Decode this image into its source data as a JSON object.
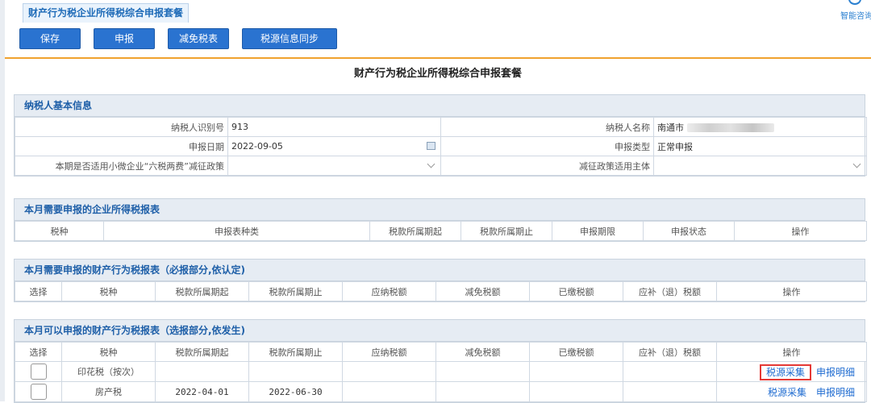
{
  "tab": {
    "title": "财产行为税企业所得税综合申报套餐"
  },
  "assistant": {
    "label": "智能咨询"
  },
  "toolbar": {
    "save": "保存",
    "submit": "申报",
    "reduction": "减免税表",
    "sync": "税源信息同步"
  },
  "page_title": "财产行为税企业所得税综合申报套餐",
  "basic": {
    "title": "纳税人基本信息",
    "tax_id_label": "纳税人识别号",
    "tax_id_value": "913",
    "name_label": "纳税人名称",
    "name_value": "南通市",
    "date_label": "申报日期",
    "date_value": "2022-09-05",
    "type_label": "申报类型",
    "type_value": "正常申报",
    "policy_label": "本期是否适用小微企业“六税两费”减征政策",
    "policy_value": "",
    "subject_label": "减征政策适用主体",
    "subject_value": ""
  },
  "income": {
    "title": "本月需要申报的企业所得税报表",
    "headers": [
      "税种",
      "申报表种类",
      "税款所属期起",
      "税款所属期止",
      "申报期限",
      "申报状态",
      "操作"
    ]
  },
  "required": {
    "title": "本月需要申报的财产行为税报表（必报部分,依认定)",
    "headers": [
      "选择",
      "税种",
      "税款所属期起",
      "税款所属期止",
      "应纳税额",
      "减免税额",
      "已缴税额",
      "应补（退）税额",
      "操作"
    ]
  },
  "optional": {
    "title": "本月可以申报的财产行为税报表（选报部分,依发生)",
    "headers": [
      "选择",
      "税种",
      "税款所属期起",
      "税款所属期止",
      "应纳税额",
      "减免税额",
      "已缴税额",
      "应补（退）税额",
      "操作"
    ],
    "rows": [
      {
        "tax": "印花税（按次）",
        "start": "",
        "end": "",
        "action1": "税源采集",
        "action2": "申报明细"
      },
      {
        "tax": "房产税",
        "start": "2022-04-01",
        "end": "2022-06-30",
        "action1": "税源采集",
        "action2": "申报明细"
      }
    ]
  },
  "colors": {
    "accent": "#2a73d0",
    "header_bg": "#e6ecf3",
    "divider": "#f0a22e",
    "highlight": "#e53935"
  }
}
